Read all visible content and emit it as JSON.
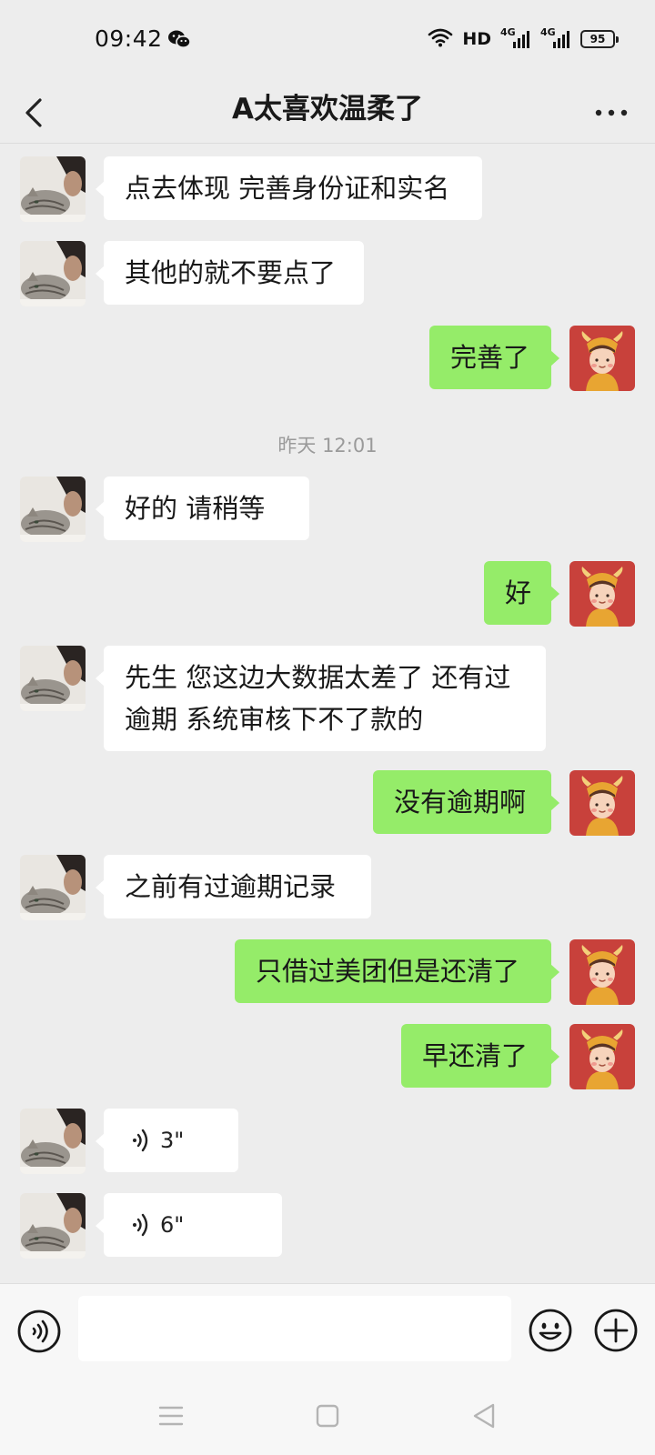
{
  "status_bar": {
    "time": "09:42",
    "network": "HD",
    "signal_1": "4G",
    "signal_2": "4G",
    "battery": "95"
  },
  "header": {
    "title": "A太喜欢温柔了",
    "back_icon": "chevron-left-icon",
    "more_icon": "more-dots-icon"
  },
  "chat": {
    "timestamp": "昨天 12:01",
    "messages": [
      {
        "side": "left",
        "text": "点去体现 完善身份证和实名"
      },
      {
        "side": "left",
        "text": "其他的就不要点了"
      },
      {
        "side": "right",
        "text": "完善了"
      },
      {
        "side": "left",
        "text": "好的  请稍等"
      },
      {
        "side": "right",
        "text": "好"
      },
      {
        "side": "left",
        "text": "先生 您这边大数据太差了  还有过逾期  系统审核下不了款的"
      },
      {
        "side": "right",
        "text": "没有逾期啊"
      },
      {
        "side": "left",
        "text": "之前有过逾期记录"
      },
      {
        "side": "right",
        "text": "只借过美团但是还清了"
      },
      {
        "side": "right",
        "text": "早还清了"
      },
      {
        "side": "left",
        "type": "voice",
        "duration": "3\""
      },
      {
        "side": "left",
        "type": "voice",
        "duration": "6\""
      }
    ]
  },
  "input_bar": {
    "voice_icon": "voice-input-icon",
    "text_value": "",
    "emoji_icon": "emoji-icon",
    "plus_icon": "plus-icon"
  },
  "nav_bar": {
    "items": [
      "menu-icon",
      "home-icon",
      "back-icon"
    ]
  },
  "colors": {
    "chat_background": "#ededed",
    "incoming_bubble": "#ffffff",
    "outgoing_bubble": "#95ec69",
    "bar_background": "#f7f7f7"
  }
}
